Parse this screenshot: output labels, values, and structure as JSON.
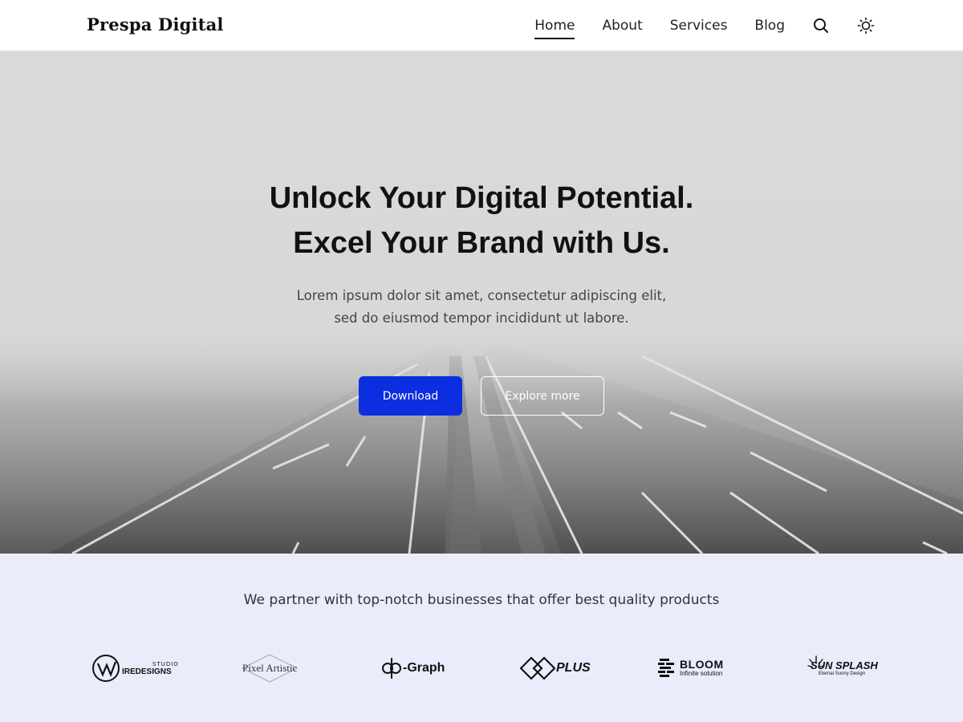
{
  "header": {
    "brand": "Prespa Digital",
    "nav": [
      {
        "label": "Home",
        "active": true
      },
      {
        "label": "About",
        "active": false
      },
      {
        "label": "Services",
        "active": false
      },
      {
        "label": "Blog",
        "active": false
      }
    ],
    "icons": [
      "search-icon",
      "sun-icon"
    ]
  },
  "hero": {
    "title_line1": "Unlock Your Digital Potential.",
    "title_line2": "Excel Your Brand with Us.",
    "subtitle_line1": "Lorem ipsum dolor sit amet, consectetur adipiscing elit,",
    "subtitle_line2": "sed do eiusmod tempor incididunt ut labore.",
    "primary_button": "Download",
    "secondary_button": "Explore more",
    "primary_color": "#0a2ee0"
  },
  "partners": {
    "heading": "We partner with top-notch businesses that offer best quality products",
    "logos": [
      {
        "name": "Studio Wiredesigns",
        "line1": "STUDIO",
        "line2": "IREDESIGNS"
      },
      {
        "name": "Pixel Artistic",
        "text": "Pixel Artistic"
      },
      {
        "name": "dp-Graph",
        "text": "-Graph"
      },
      {
        "name": "Plus",
        "text": "PLUS"
      },
      {
        "name": "Bloom",
        "line1": "BLOOM",
        "line2": "Infinite solution"
      },
      {
        "name": "Sun Splash",
        "line1": "SUN SPLASH",
        "line2": "Eternal Sunny Design"
      }
    ],
    "background": "#eaecfb"
  }
}
